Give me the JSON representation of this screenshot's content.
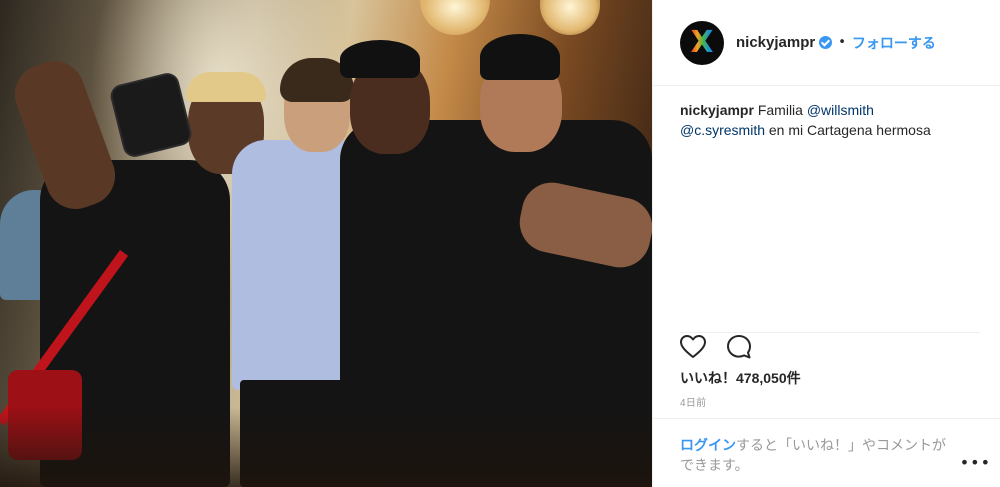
{
  "post": {
    "username": "nickyjampr",
    "follow_label": "フォローする",
    "separator": "•",
    "caption": {
      "username": "nickyjampr",
      "text_1": " Familia ",
      "mention_1": "@willsmith",
      "mention_2": "@c.syresmith",
      "text_2": " en mi Cartagena hermosa"
    },
    "likes_label": "いいね！478,050件",
    "time_ago": "4日前",
    "login_prompt": {
      "link_label": "ログイン",
      "rest": "すると「いいね！」やコメントができます。"
    },
    "more_label": "•••"
  },
  "colors": {
    "link_blue": "#3897f0",
    "mention_blue": "#003569",
    "muted_grey": "#999999",
    "divider": "#efefef"
  },
  "icons": {
    "like": "heart-icon",
    "comment": "comment-bubble-icon",
    "verified": "verified-badge-icon",
    "more": "more-options-icon"
  }
}
